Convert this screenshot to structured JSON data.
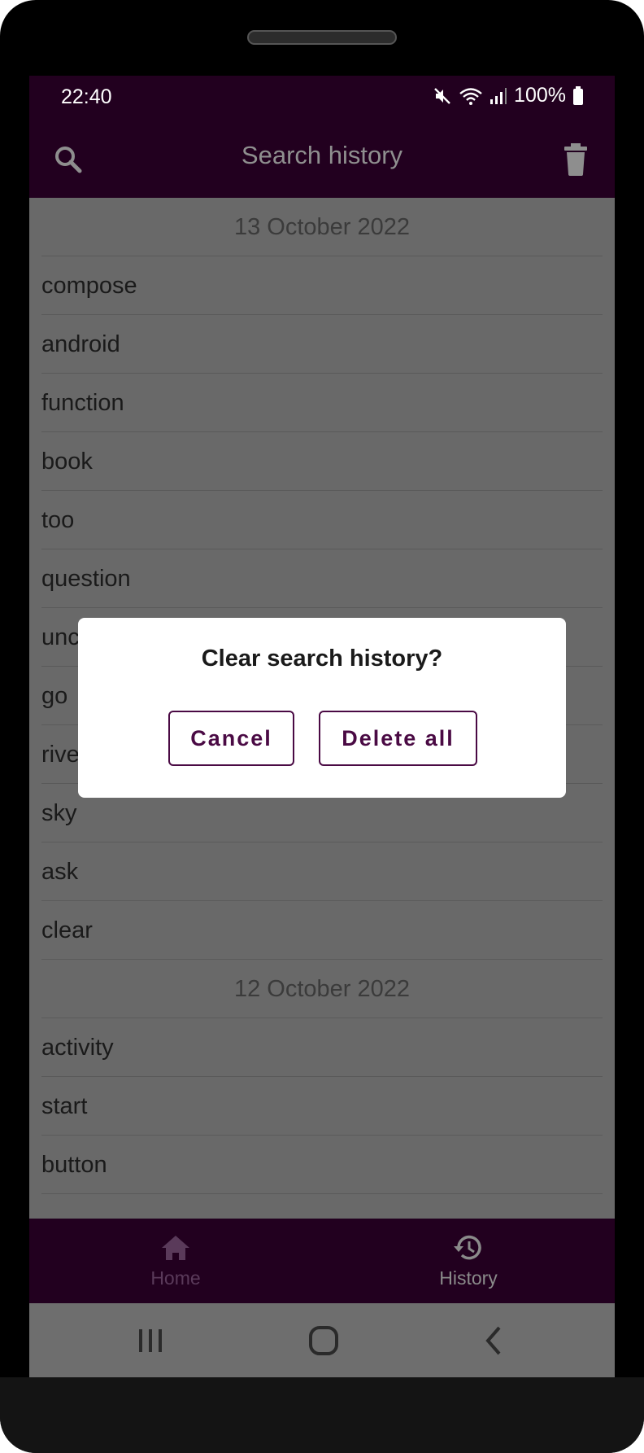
{
  "status": {
    "time": "22:40",
    "battery": "100%"
  },
  "appbar": {
    "title": "Search history"
  },
  "history": [
    {
      "kind": "date",
      "text": "13 October 2022"
    },
    {
      "kind": "item",
      "text": "compose"
    },
    {
      "kind": "item",
      "text": "android"
    },
    {
      "kind": "item",
      "text": "function"
    },
    {
      "kind": "item",
      "text": "book"
    },
    {
      "kind": "item",
      "text": "too"
    },
    {
      "kind": "item",
      "text": "question"
    },
    {
      "kind": "item",
      "text": "unc"
    },
    {
      "kind": "item",
      "text": "go"
    },
    {
      "kind": "item",
      "text": "rive"
    },
    {
      "kind": "item",
      "text": "sky"
    },
    {
      "kind": "item",
      "text": "ask"
    },
    {
      "kind": "item",
      "text": "clear"
    },
    {
      "kind": "date",
      "text": "12 October 2022"
    },
    {
      "kind": "item",
      "text": "activity"
    },
    {
      "kind": "item",
      "text": "start"
    },
    {
      "kind": "item",
      "text": "button"
    }
  ],
  "nav": {
    "home": "Home",
    "history": "History"
  },
  "dialog": {
    "title": "Clear search history?",
    "cancel": "Cancel",
    "delete_all": "Delete all"
  },
  "colors": {
    "brand": "#22001f",
    "accent": "#4a0a44",
    "scrim": "#696969"
  }
}
